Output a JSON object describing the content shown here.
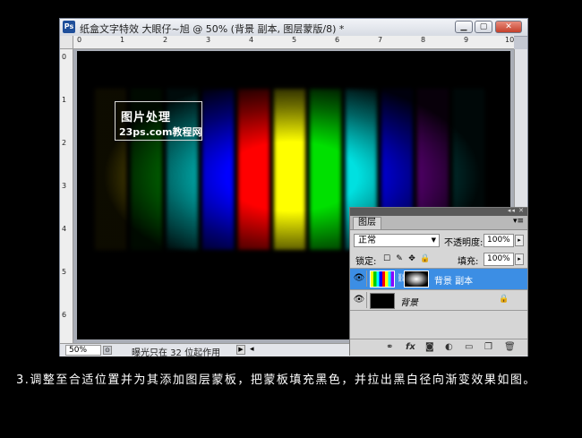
{
  "window": {
    "app_icon": "Ps",
    "title": "纸盒文字特效 大眼仔~旭 @ 50% (背景 副本, 图层蒙版/8) *",
    "minimize_icon": "minimize-icon",
    "maximize_icon": "maximize-icon",
    "close_icon": "close-icon"
  },
  "rulers": {
    "horizontal": [
      "0",
      "1",
      "2",
      "3",
      "4",
      "5",
      "6",
      "7",
      "8",
      "9",
      "10"
    ],
    "vertical": [
      "0",
      "1",
      "2",
      "3",
      "4",
      "5",
      "6"
    ]
  },
  "canvas": {
    "background": "#000000",
    "stripe_colors": [
      "#ffe000",
      "#00c000",
      "#00d0d0",
      "#0000ff",
      "#ff0000",
      "#ffff00",
      "#00e000",
      "#00e0e0",
      "#0000ff",
      "#9a00c8",
      "#00a0a0"
    ],
    "watermark": {
      "line1": "图片处理",
      "line2": "23ps.com",
      "line3": "教程网"
    }
  },
  "status": {
    "zoom": "50%",
    "message": "曝光只在 32 位起作用"
  },
  "layers_panel": {
    "tab": "图层",
    "blend_mode": "正常",
    "opacity_label": "不透明度:",
    "opacity_value": "100%",
    "lock_label": "锁定:",
    "fill_label": "填充:",
    "fill_value": "100%",
    "layers": [
      {
        "name": "背景 副本",
        "selected": true,
        "has_mask": true
      },
      {
        "name": "背景",
        "selected": false,
        "locked": true
      }
    ],
    "bottom_icons": [
      "link-icon",
      "fx-icon",
      "add-mask-icon",
      "adjustment-icon",
      "group-icon",
      "new-layer-icon",
      "trash-icon"
    ]
  },
  "caption": {
    "text": "3.调整至合适位置并为其添加图层蒙板，把蒙板填充黑色，并拉出黑白径向渐变效果如图。"
  }
}
